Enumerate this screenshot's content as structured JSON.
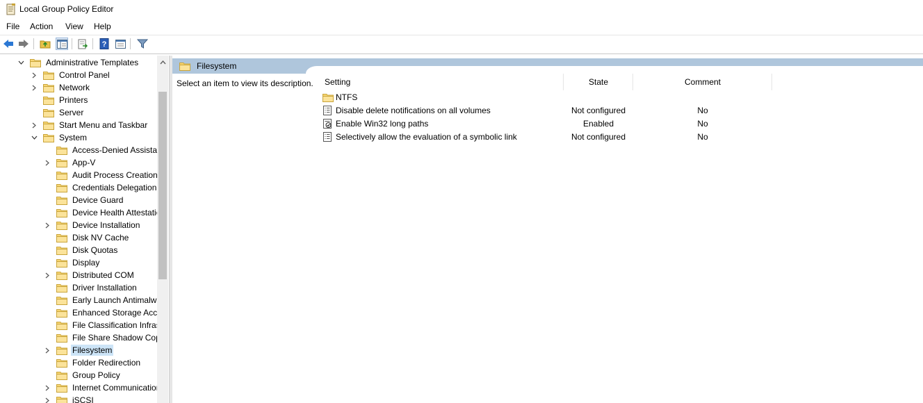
{
  "window": {
    "title": "Local Group Policy Editor",
    "app_icon": "policy-document-icon"
  },
  "menu": [
    "File",
    "Action",
    "View",
    "Help"
  ],
  "toolbar": {
    "buttons": [
      "back-arrow-icon",
      "forward-arrow-icon",
      "up-folder-icon",
      "show-hide-tree-icon",
      "export-list-icon",
      "help-icon",
      "properties-view-icon",
      "filter-icon"
    ]
  },
  "tree": {
    "items": [
      {
        "label": "Administrative Templates"
      },
      {
        "label": "Control Panel"
      },
      {
        "label": "Network"
      },
      {
        "label": "Printers"
      },
      {
        "label": "Server"
      },
      {
        "label": "Start Menu and Taskbar"
      },
      {
        "label": "System"
      },
      {
        "label": "Access-Denied Assistance"
      },
      {
        "label": "App-V"
      },
      {
        "label": "Audit Process Creation"
      },
      {
        "label": "Credentials Delegation"
      },
      {
        "label": "Device Guard"
      },
      {
        "label": "Device Health Attestation Service"
      },
      {
        "label": "Device Installation"
      },
      {
        "label": "Disk NV Cache"
      },
      {
        "label": "Disk Quotas"
      },
      {
        "label": "Display"
      },
      {
        "label": "Distributed COM"
      },
      {
        "label": "Driver Installation"
      },
      {
        "label": "Early Launch Antimalware"
      },
      {
        "label": "Enhanced Storage Access"
      },
      {
        "label": "File Classification Infrastructure"
      },
      {
        "label": "File Share Shadow Copy Provider"
      },
      {
        "label": "Filesystem"
      },
      {
        "label": "Folder Redirection"
      },
      {
        "label": "Group Policy"
      },
      {
        "label": "Internet Communication Management"
      },
      {
        "label": "iSCSI"
      }
    ]
  },
  "details": {
    "header_title": "Filesystem",
    "description": "Select an item to view its description.",
    "columns": {
      "setting": "Setting",
      "state": "State",
      "comment": "Comment"
    },
    "rows": [
      {
        "name": "NTFS",
        "state": "",
        "comment": "",
        "icon": "folder-icon"
      },
      {
        "name": "Disable delete notifications on all volumes",
        "state": "Not configured",
        "comment": "No",
        "icon": "policy-setting-icon"
      },
      {
        "name": "Enable Win32 long paths",
        "state": "Enabled",
        "comment": "No",
        "icon": "policy-enabled-icon"
      },
      {
        "name": "Selectively allow the evaluation of a symbolic link",
        "state": "Not configured",
        "comment": "No",
        "icon": "policy-setting-icon"
      }
    ]
  }
}
